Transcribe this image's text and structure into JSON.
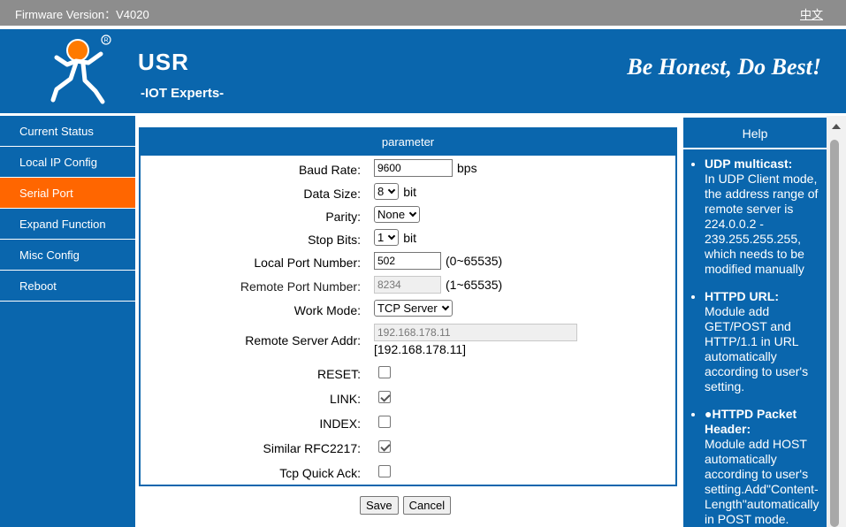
{
  "topbar": {
    "firmware": "Firmware Version：V4020",
    "lang_link": "中文"
  },
  "header": {
    "brand": "USR",
    "sub": "-IOT Experts-",
    "slogan": "Be Honest, Do Best!"
  },
  "sidebar": {
    "items": [
      {
        "label": "Current Status"
      },
      {
        "label": "Local IP Config"
      },
      {
        "label": "Serial Port",
        "active": true
      },
      {
        "label": "Expand Function"
      },
      {
        "label": "Misc Config"
      },
      {
        "label": "Reboot"
      }
    ]
  },
  "panel": {
    "title": "parameter",
    "baud": {
      "label": "Baud Rate:",
      "value": "9600",
      "unit": "bps"
    },
    "data_size": {
      "label": "Data Size:",
      "value": "8",
      "unit": "bit"
    },
    "parity": {
      "label": "Parity:",
      "value": "None"
    },
    "stop_bits": {
      "label": "Stop Bits:",
      "value": "1",
      "unit": "bit"
    },
    "local_port": {
      "label": "Local Port Number:",
      "value": "502",
      "range": "(0~65535)"
    },
    "remote_port": {
      "label": "Remote Port Number:",
      "value": "8234",
      "range": "(1~65535)"
    },
    "work_mode": {
      "label": "Work Mode:",
      "value": "TCP Server"
    },
    "remote_addr": {
      "label": "Remote Server Addr:",
      "value": "192.168.178.11",
      "display": "[192.168.178.11]"
    },
    "reset": {
      "label": "RESET:",
      "checked": false
    },
    "link": {
      "label": "LINK:",
      "checked": true
    },
    "index": {
      "label": "INDEX:",
      "checked": false
    },
    "rfc2217": {
      "label": "Similar RFC2217:",
      "checked": true
    },
    "quick_ack": {
      "label": "Tcp Quick Ack:",
      "checked": false
    }
  },
  "buttons": {
    "save": "Save",
    "cancel": "Cancel"
  },
  "help": {
    "title": "Help",
    "items": [
      {
        "head": "UDP multicast:",
        "text": "In UDP Client mode, the address range of remote server is 224.0.0.2 - 239.255.255.255, which needs to be modified manually"
      },
      {
        "head": "HTTPD URL:",
        "text": "Module add GET/POST and HTTP/1.1 in URL automatically according to user's setting."
      },
      {
        "head": "●HTTPD Packet Header:",
        "text": "Module add HOST automatically according to user's setting.Add\"Content-Length\"automatically in POST mode."
      }
    ]
  },
  "colors": {
    "brand_blue": "#0a66ad",
    "active_orange": "#ff6600"
  }
}
